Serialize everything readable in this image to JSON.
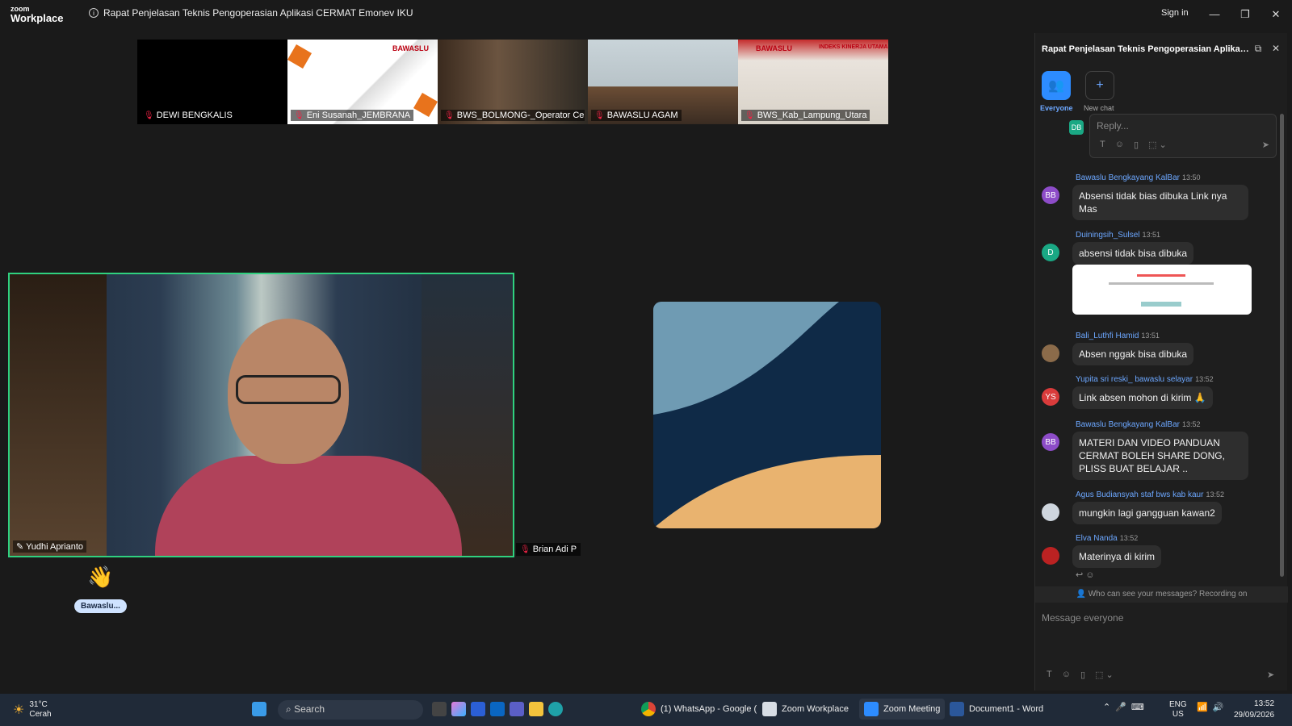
{
  "app": {
    "logo_top": "zoom",
    "logo_bottom": "Workplace",
    "title": "Rapat Penjelasan Teknis Pengoperasian Aplikasi CERMAT Emonev IKU",
    "signin": "Sign in"
  },
  "tiles": [
    {
      "name": "DEWI BENGKALIS"
    },
    {
      "name": "Eni Susanah_JEMBRANA",
      "brand": "BAWASLU"
    },
    {
      "name": "BWS_BOLMONG-_Operator Cer..."
    },
    {
      "name": "BAWASLU AGAM"
    },
    {
      "name": "BWS_Kab_Lampung_Utara",
      "brand": "BAWASLU",
      "brand2": "INDEKS KINERJA UTAMA"
    }
  ],
  "main_video": {
    "name": "Yudhi Aprianto"
  },
  "second_video": {
    "name": "Brian Adi P"
  },
  "raised": {
    "name": "Bawaslu...",
    "icon": "waving-hand-icon"
  },
  "colors": {
    "speaker_border": "#2fd17f",
    "accent": "#2d8cff"
  },
  "chat": {
    "title": "Rapat Penjelasan Teknis Pengoperasian Aplikas...",
    "tab_everyone": "Everyone",
    "tab_new": "New chat",
    "reply_placeholder": "Reply...",
    "reply_avatar": "DB",
    "messages": [
      {
        "avatar": "BB",
        "sender": "Bawaslu Bengkayang KalBar",
        "time": "13:50",
        "text": "Absensi tidak bias dibuka Link nya Mas"
      },
      {
        "avatar": "D",
        "sender": "Duiningsih_Sulsel",
        "time": "13:51",
        "text": "absensi tidak bisa dibuka"
      },
      {
        "avatar": "",
        "sender": "Bali_Luthfi Hamid",
        "time": "13:51",
        "text": "Absen nggak bisa dibuka"
      },
      {
        "avatar": "YS",
        "sender": "Yupita sri reski_ bawaslu selayar",
        "time": "13:52",
        "text": "Link absen  mohon di kirim 🙏"
      },
      {
        "avatar": "BB",
        "sender": "Bawaslu Bengkayang KalBar",
        "time": "13:52",
        "text": "MATERI DAN VIDEO PANDUAN CERMAT BOLEH SHARE DONG, PLISS BUAT BELAJAR .."
      },
      {
        "avatar": "",
        "sender": "Agus Budiansyah staf bws kab kaur",
        "time": "13:52",
        "text": "mungkin lagi gangguan kawan2"
      },
      {
        "avatar": "",
        "sender": "Elva Nanda",
        "time": "13:52",
        "text": "Materinya di kirim"
      }
    ],
    "visibility": "Who can see your messages? Recording on",
    "compose_placeholder": "Message everyone"
  },
  "taskbar": {
    "weather_temp": "31°C",
    "weather_desc": "Cerah",
    "search": "Search",
    "apps": [
      "(1) WhatsApp - Google (",
      "Zoom Workplace",
      "Zoom Meeting",
      "Document1 - Word"
    ],
    "lang": "ENG",
    "region": "US",
    "time": "13:52",
    "date": "29/09/2026"
  }
}
